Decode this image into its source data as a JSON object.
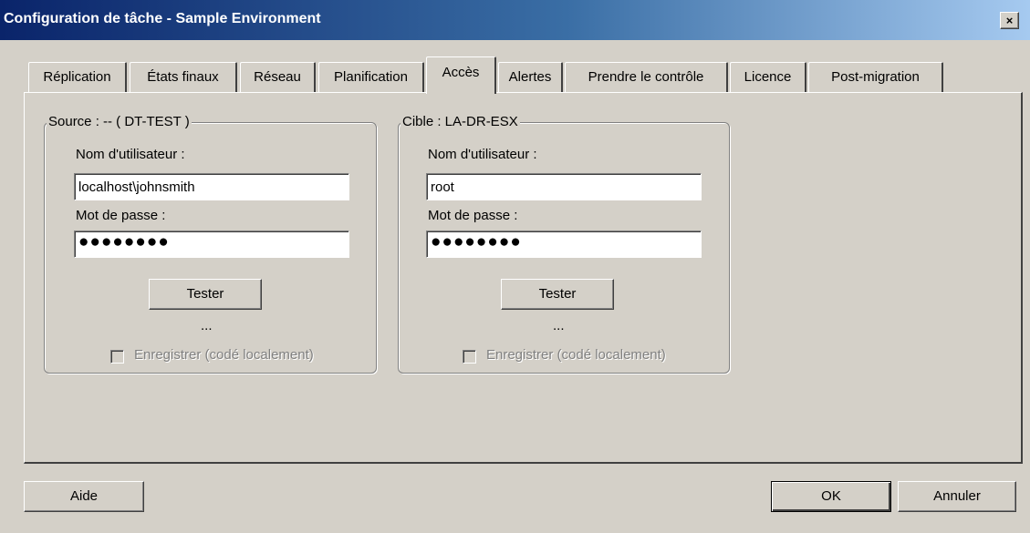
{
  "window": {
    "title": "Configuration de tâche - Sample Environment",
    "close_glyph": "×"
  },
  "tabs": [
    {
      "label": "Réplication"
    },
    {
      "label": "États finaux"
    },
    {
      "label": "Réseau"
    },
    {
      "label": "Planification"
    },
    {
      "label": "Accès",
      "active": true
    },
    {
      "label": "Alertes"
    },
    {
      "label": "Prendre le contrôle"
    },
    {
      "label": "Licence"
    },
    {
      "label": "Post-migration"
    }
  ],
  "source": {
    "legend": "Source : -- ( DT-TEST )",
    "username_label": "Nom d'utilisateur :",
    "username_value": "localhost\\johnsmith",
    "password_label": "Mot de passe :",
    "password_value": "●●●●●●●●",
    "test_button": "Tester",
    "status": "...",
    "save_label": "Enregistrer (codé localement)",
    "save_checked": false
  },
  "target": {
    "legend": "Cible : LA-DR-ESX",
    "username_label": "Nom d'utilisateur :",
    "username_value": "root",
    "password_label": "Mot de passe :",
    "password_value": "●●●●●●●●",
    "test_button": "Tester",
    "status": "...",
    "save_label": "Enregistrer (codé localement)",
    "save_checked": false
  },
  "footer": {
    "help_button": "Aide",
    "ok_button": "OK",
    "cancel_button": "Annuler"
  }
}
